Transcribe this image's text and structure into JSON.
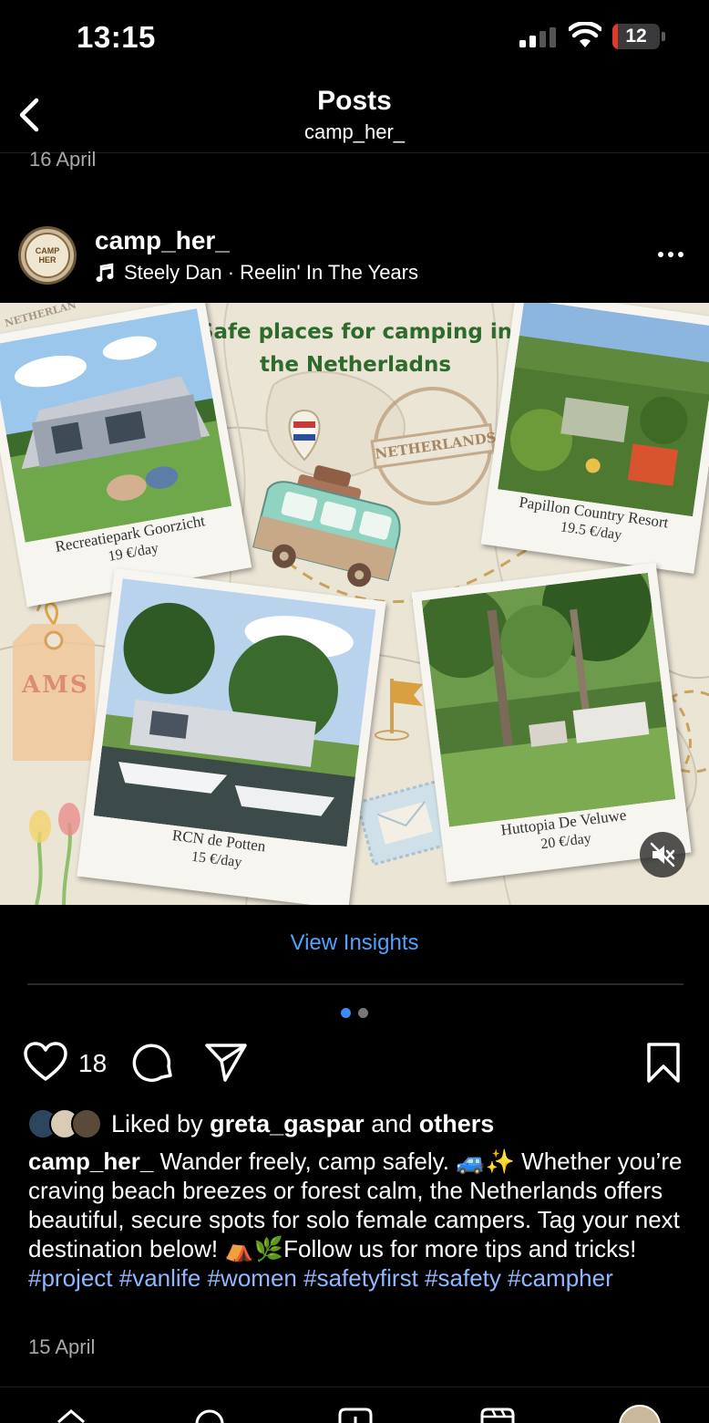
{
  "status_bar": {
    "time": "13:15",
    "battery_level": "12",
    "signal_bars": 2,
    "colors": {
      "battery": "#e0382d"
    }
  },
  "header": {
    "title": "Posts",
    "subtitle": "camp_her_",
    "back_icon": "chevron-left-icon"
  },
  "previous_post": {
    "date": "16 April"
  },
  "post": {
    "username": "camp_her_",
    "avatar_text": "CAMP HER",
    "music": "Steely Dan · Reelin' In The Years",
    "image": {
      "title": "Safe places for camping  in the Netherladns",
      "stamp_text": "NETHERLANDS",
      "stamp_top": "NETHERLAN",
      "tag_text": "AMS",
      "places": [
        {
          "name": "Recreatiepark Goorzicht",
          "price": "19 €/day"
        },
        {
          "name": "Papillon Country Resort",
          "price": "19.5 €/day"
        },
        {
          "name": "RCN de Potten",
          "price": "15 €/day"
        },
        {
          "name": "Huttopia De Veluwe",
          "price": "20 €/day"
        }
      ]
    },
    "insights_label": "View Insights",
    "carousel": {
      "count": 2,
      "active": 0
    },
    "likes": "18",
    "liked_by": {
      "prefix": "Liked by",
      "user": "greta_gaspar",
      "joiner": "and",
      "others": "others"
    },
    "caption": {
      "author": "camp_her_",
      "text": "Wander freely, camp safely. 🚙✨ Whether you’re craving beach breezes or forest calm, the Netherlands offers beautiful, secure spots for solo female campers. Tag your next destination below! ⛺🌿Follow us for more tips and tricks!",
      "hashtags": [
        "#project",
        "#vanlife",
        "#women",
        "#safetyfirst",
        "#safety",
        "#campher"
      ]
    },
    "date": "15 April"
  },
  "colors": {
    "link_blue": "#4da3ff",
    "hashtag": "#8fb8ff",
    "title_green": "#2f6a2d",
    "dot_active": "#3b8cf5",
    "dot_inactive": "#777777"
  }
}
